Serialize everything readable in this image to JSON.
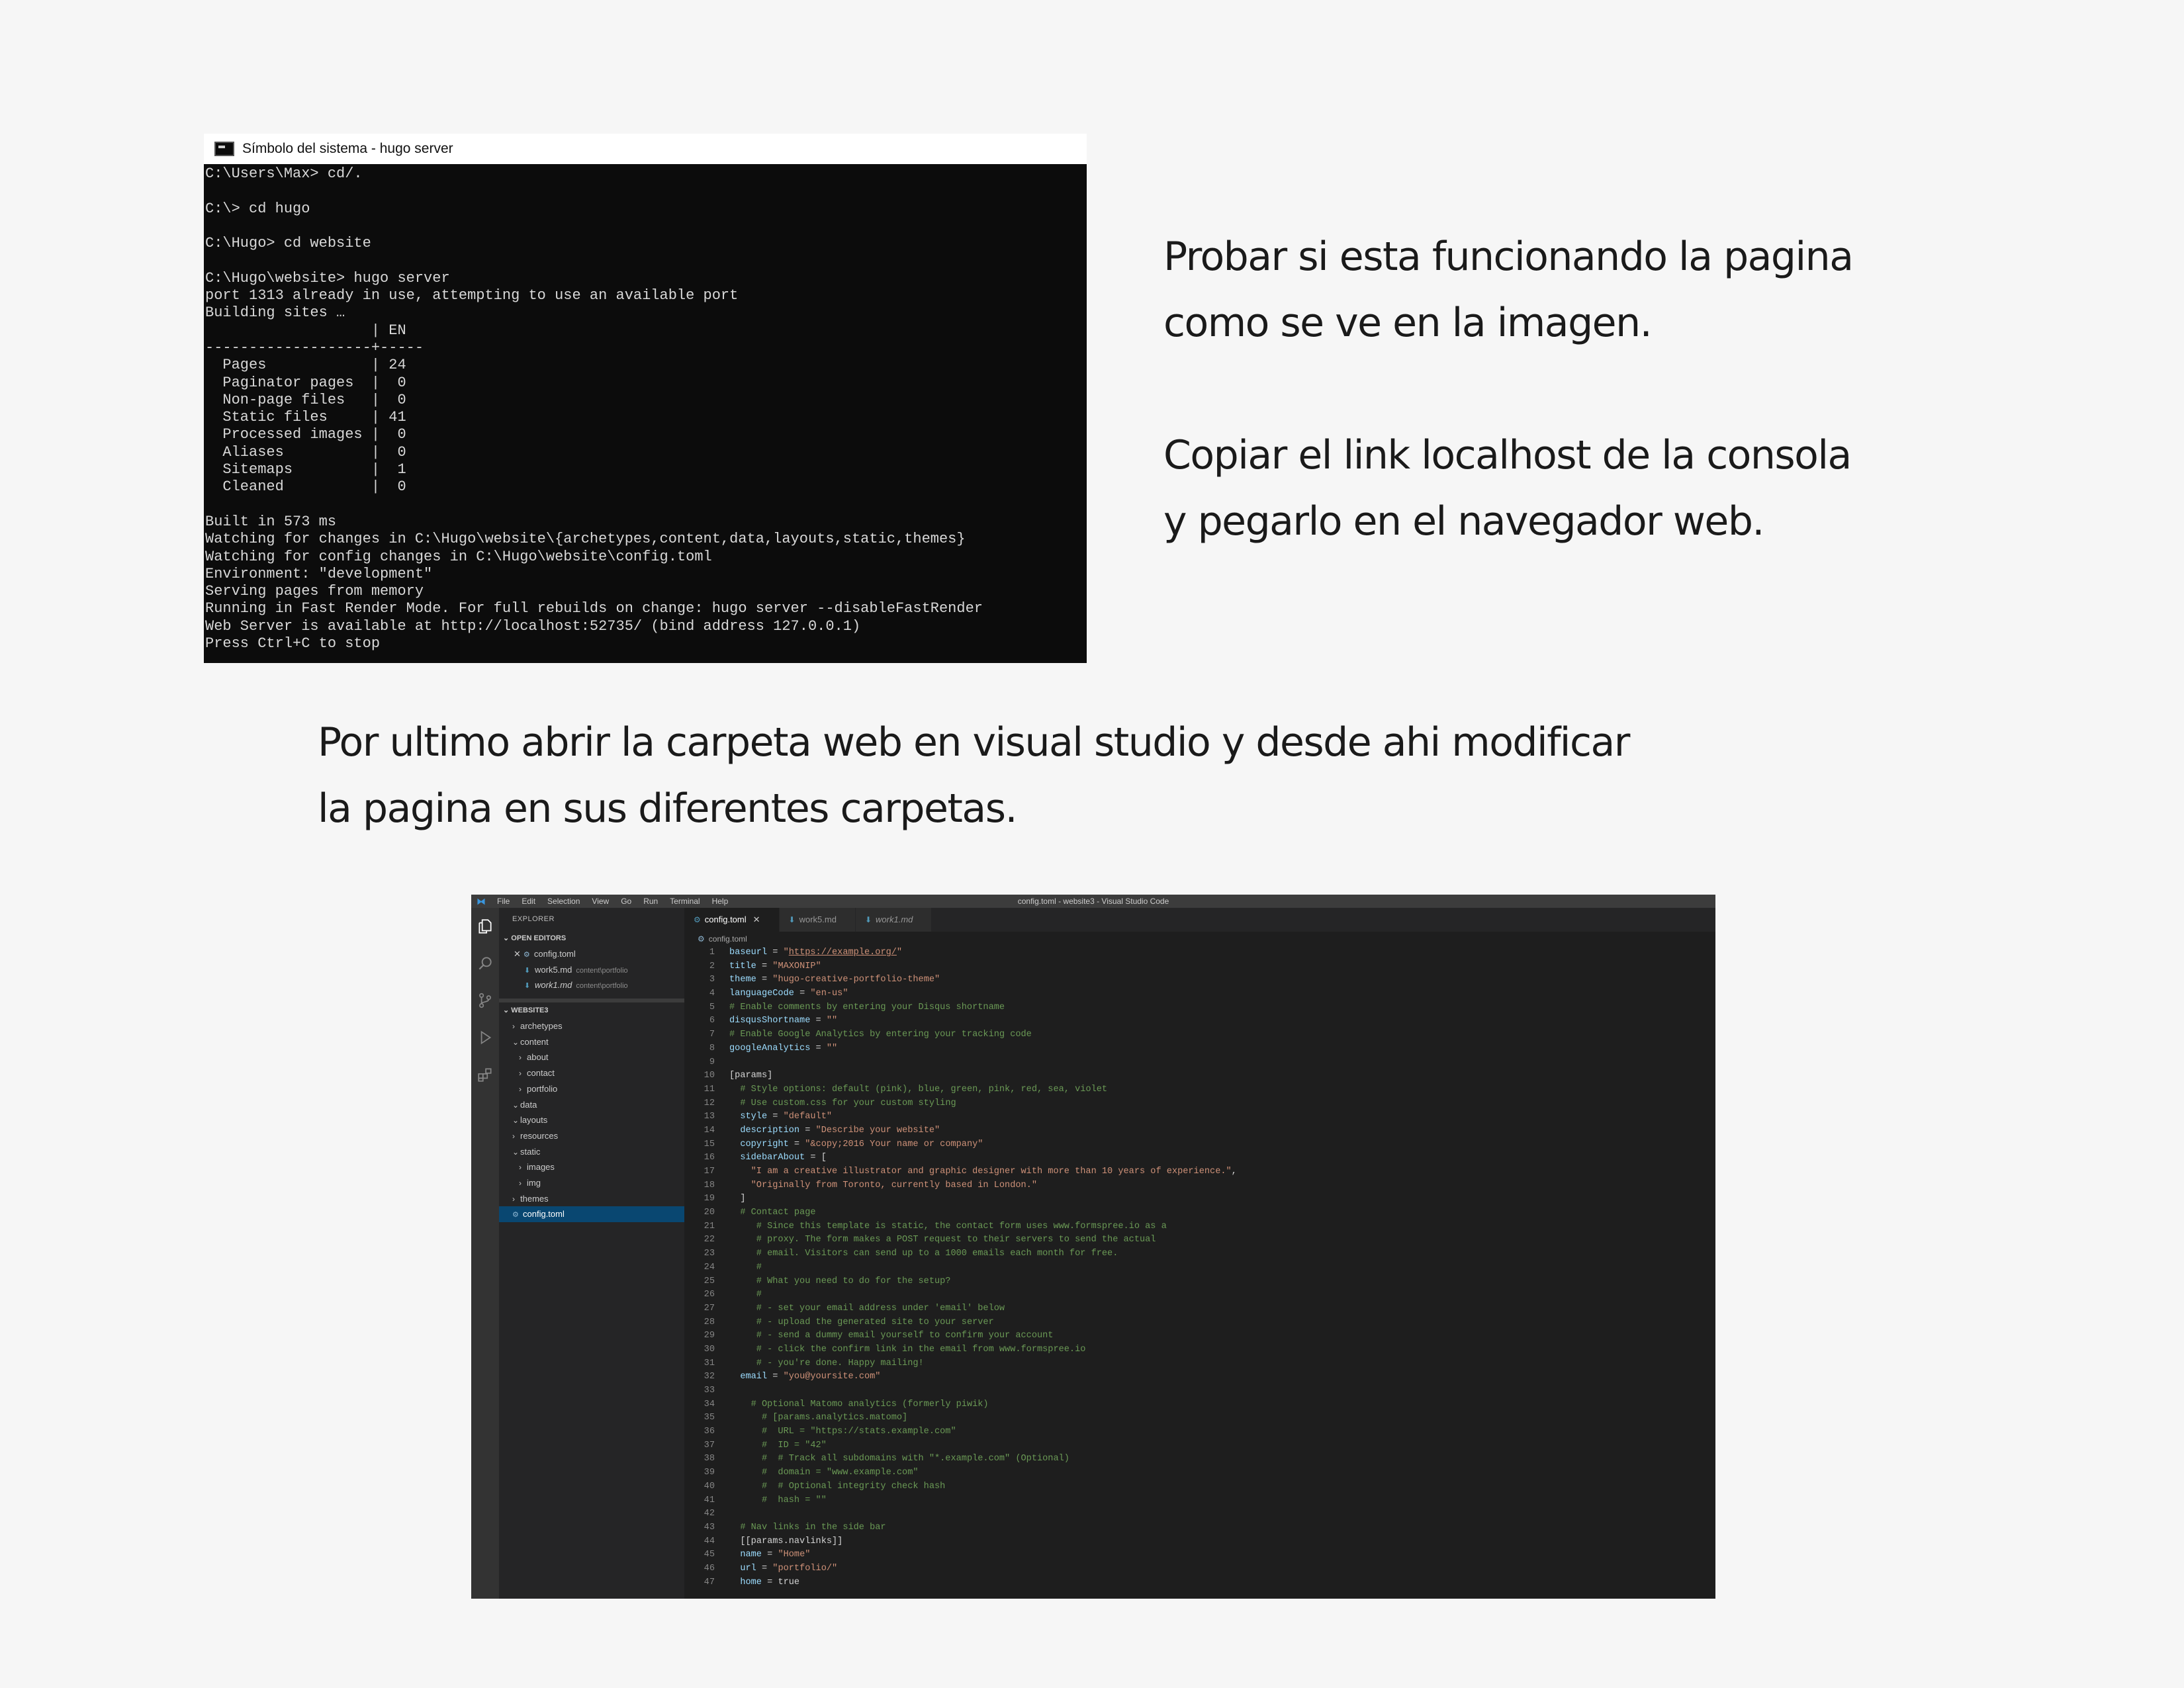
{
  "terminal": {
    "title": "Símbolo del sistema - hugo  server",
    "lines": [
      "C:\\Users\\Max> cd/.",
      "",
      "C:\\> cd hugo",
      "",
      "C:\\Hugo> cd website",
      "",
      "C:\\Hugo\\website> hugo server",
      "port 1313 already in use, attempting to use an available port",
      "Building sites …",
      "                   | EN",
      "-------------------+-----",
      "  Pages            | 24",
      "  Paginator pages  |  0",
      "  Non-page files   |  0",
      "  Static files     | 41",
      "  Processed images |  0",
      "  Aliases          |  0",
      "  Sitemaps         |  1",
      "  Cleaned          |  0",
      "",
      "Built in 573 ms",
      "Watching for changes in C:\\Hugo\\website\\{archetypes,content,data,layouts,static,themes}",
      "Watching for config changes in C:\\Hugo\\website\\config.toml",
      "Environment: \"development\"",
      "Serving pages from memory",
      "Running in Fast Render Mode. For full rebuilds on change: hugo server --disableFastRender",
      "Web Server is available at http://localhost:52735/ (bind address 127.0.0.1)",
      "Press Ctrl+C to stop"
    ]
  },
  "instructions": {
    "step1_line1": "Probar si esta funcionando la pagina",
    "step1_line2": "como se ve en la imagen.",
    "step2_line1": "Copiar el link localhost de la consola",
    "step2_line2": "y pegarlo en el navegador web.",
    "step3_line1": "Por ultimo abrir la carpeta web en visual studio y desde ahi modificar",
    "step3_line2": "la pagina en sus diferentes carpetas."
  },
  "vscode": {
    "window_title": "config.toml - website3 - Visual Studio Code",
    "menu": [
      "File",
      "Edit",
      "Selection",
      "View",
      "Go",
      "Run",
      "Terminal",
      "Help"
    ],
    "activity_icons": [
      "explorer-icon",
      "search-icon",
      "source-control-icon",
      "run-debug-icon",
      "extensions-icon"
    ],
    "sidebar": {
      "title": "EXPLORER",
      "open_editors_label": "OPEN EDITORS",
      "open_editors": [
        {
          "name": "config.toml",
          "path": ""
        },
        {
          "name": "work5.md",
          "path": "content\\portfolio"
        },
        {
          "name": "work1.md",
          "path": "content\\portfolio"
        }
      ],
      "project_label": "WEBSITE3",
      "tree": [
        {
          "name": "archetypes",
          "chev": "›",
          "depth": 0
        },
        {
          "name": "content",
          "chev": "⌄",
          "depth": 0
        },
        {
          "name": "about",
          "chev": "›",
          "depth": 1
        },
        {
          "name": "contact",
          "chev": "›",
          "depth": 1
        },
        {
          "name": "portfolio",
          "chev": "›",
          "depth": 1
        },
        {
          "name": "data",
          "chev": "⌄",
          "depth": 0
        },
        {
          "name": "layouts",
          "chev": "⌄",
          "depth": 0
        },
        {
          "name": "resources",
          "chev": "›",
          "depth": 0
        },
        {
          "name": "static",
          "chev": "⌄",
          "depth": 0
        },
        {
          "name": "images",
          "chev": "›",
          "depth": 1
        },
        {
          "name": "img",
          "chev": "›",
          "depth": 1
        },
        {
          "name": "themes",
          "chev": "›",
          "depth": 0
        },
        {
          "name": "config.toml",
          "chev": "",
          "depth": 0,
          "file": true
        }
      ]
    },
    "tabs": [
      {
        "name": "config.toml",
        "active": true,
        "italic": false
      },
      {
        "name": "work5.md",
        "active": false,
        "italic": false
      },
      {
        "name": "work1.md",
        "active": false,
        "italic": true
      }
    ],
    "breadcrumb": "config.toml",
    "code": [
      [
        [
          "k",
          "baseurl"
        ],
        [
          "p",
          " = "
        ],
        [
          "s",
          "\"https://example.org/\""
        ]
      ],
      [
        [
          "k",
          "title"
        ],
        [
          "p",
          " = "
        ],
        [
          "s",
          "\"MAXONIP\""
        ]
      ],
      [
        [
          "k",
          "theme"
        ],
        [
          "p",
          " = "
        ],
        [
          "s",
          "\"hugo-creative-portfolio-theme\""
        ]
      ],
      [
        [
          "k",
          "languageCode"
        ],
        [
          "p",
          " = "
        ],
        [
          "s",
          "\"en-us\""
        ]
      ],
      [
        [
          "c",
          "# Enable comments by entering your Disqus shortname"
        ]
      ],
      [
        [
          "k",
          "disqusShortname"
        ],
        [
          "p",
          " = "
        ],
        [
          "s",
          "\"\""
        ]
      ],
      [
        [
          "c",
          "# Enable Google Analytics by entering your tracking code"
        ]
      ],
      [
        [
          "k",
          "googleAnalytics"
        ],
        [
          "p",
          " = "
        ],
        [
          "s",
          "\"\""
        ]
      ],
      [],
      [
        [
          "b",
          "[params]"
        ]
      ],
      [
        [
          "p",
          "  "
        ],
        [
          "c",
          "# Style options: default (pink), blue, green, pink, red, sea, violet"
        ]
      ],
      [
        [
          "p",
          "  "
        ],
        [
          "c",
          "# Use custom.css for your custom styling"
        ]
      ],
      [
        [
          "p",
          "  "
        ],
        [
          "k",
          "style"
        ],
        [
          "p",
          " = "
        ],
        [
          "s",
          "\"default\""
        ]
      ],
      [
        [
          "p",
          "  "
        ],
        [
          "k",
          "description"
        ],
        [
          "p",
          " = "
        ],
        [
          "s",
          "\"Describe your website\""
        ]
      ],
      [
        [
          "p",
          "  "
        ],
        [
          "k",
          "copyright"
        ],
        [
          "p",
          " = "
        ],
        [
          "s",
          "\"&copy;2016 Your name or company\""
        ]
      ],
      [
        [
          "p",
          "  "
        ],
        [
          "k",
          "sidebarAbout"
        ],
        [
          "p",
          " = ["
        ]
      ],
      [
        [
          "p",
          "    "
        ],
        [
          "s",
          "\"I am a creative illustrator and graphic designer with more than 10 years of experience.\""
        ],
        [
          "p",
          ","
        ]
      ],
      [
        [
          "p",
          "    "
        ],
        [
          "s",
          "\"Originally from Toronto, currently based in London.\""
        ]
      ],
      [
        [
          "p",
          "  ]"
        ]
      ],
      [
        [
          "p",
          "  "
        ],
        [
          "c",
          "# Contact page"
        ]
      ],
      [
        [
          "p",
          "     "
        ],
        [
          "c",
          "# Since this template is static, the contact form uses www.formspree.io as a"
        ]
      ],
      [
        [
          "p",
          "     "
        ],
        [
          "c",
          "# proxy. The form makes a POST request to their servers to send the actual"
        ]
      ],
      [
        [
          "p",
          "     "
        ],
        [
          "c",
          "# email. Visitors can send up to a 1000 emails each month for free."
        ]
      ],
      [
        [
          "p",
          "     "
        ],
        [
          "c",
          "#"
        ]
      ],
      [
        [
          "p",
          "     "
        ],
        [
          "c",
          "# What you need to do for the setup?"
        ]
      ],
      [
        [
          "p",
          "     "
        ],
        [
          "c",
          "#"
        ]
      ],
      [
        [
          "p",
          "     "
        ],
        [
          "c",
          "# - set your email address under 'email' below"
        ]
      ],
      [
        [
          "p",
          "     "
        ],
        [
          "c",
          "# - upload the generated site to your server"
        ]
      ],
      [
        [
          "p",
          "     "
        ],
        [
          "c",
          "# - send a dummy email yourself to confirm your account"
        ]
      ],
      [
        [
          "p",
          "     "
        ],
        [
          "c",
          "# - click the confirm link in the email from www.formspree.io"
        ]
      ],
      [
        [
          "p",
          "     "
        ],
        [
          "c",
          "# - you're done. Happy mailing!"
        ]
      ],
      [
        [
          "p",
          "  "
        ],
        [
          "k",
          "email"
        ],
        [
          "p",
          " = "
        ],
        [
          "s",
          "\"you@yoursite.com\""
        ]
      ],
      [],
      [
        [
          "p",
          "    "
        ],
        [
          "c",
          "# Optional Matomo analytics (formerly piwik)"
        ]
      ],
      [
        [
          "p",
          "      "
        ],
        [
          "c",
          "# [params.analytics.matomo]"
        ]
      ],
      [
        [
          "p",
          "      "
        ],
        [
          "c",
          "#  URL = \"https://stats.example.com\""
        ]
      ],
      [
        [
          "p",
          "      "
        ],
        [
          "c",
          "#  ID = \"42\""
        ]
      ],
      [
        [
          "p",
          "      "
        ],
        [
          "c",
          "#  # Track all subdomains with \"*.example.com\" (Optional)"
        ]
      ],
      [
        [
          "p",
          "      "
        ],
        [
          "c",
          "#  domain = \"www.example.com\""
        ]
      ],
      [
        [
          "p",
          "      "
        ],
        [
          "c",
          "#  # Optional integrity check hash"
        ]
      ],
      [
        [
          "p",
          "      "
        ],
        [
          "c",
          "#  hash = \"\""
        ]
      ],
      [],
      [
        [
          "p",
          "  "
        ],
        [
          "c",
          "# Nav links in the side bar"
        ]
      ],
      [
        [
          "p",
          "  "
        ],
        [
          "b",
          "[[params.navlinks]]"
        ]
      ],
      [
        [
          "p",
          "  "
        ],
        [
          "k",
          "name"
        ],
        [
          "p",
          " = "
        ],
        [
          "s",
          "\"Home\""
        ]
      ],
      [
        [
          "p",
          "  "
        ],
        [
          "k",
          "url"
        ],
        [
          "p",
          " = "
        ],
        [
          "s",
          "\"portfolio/\""
        ]
      ],
      [
        [
          "p",
          "  "
        ],
        [
          "k",
          "home"
        ],
        [
          "p",
          " = "
        ],
        [
          "p",
          "true"
        ]
      ]
    ]
  }
}
